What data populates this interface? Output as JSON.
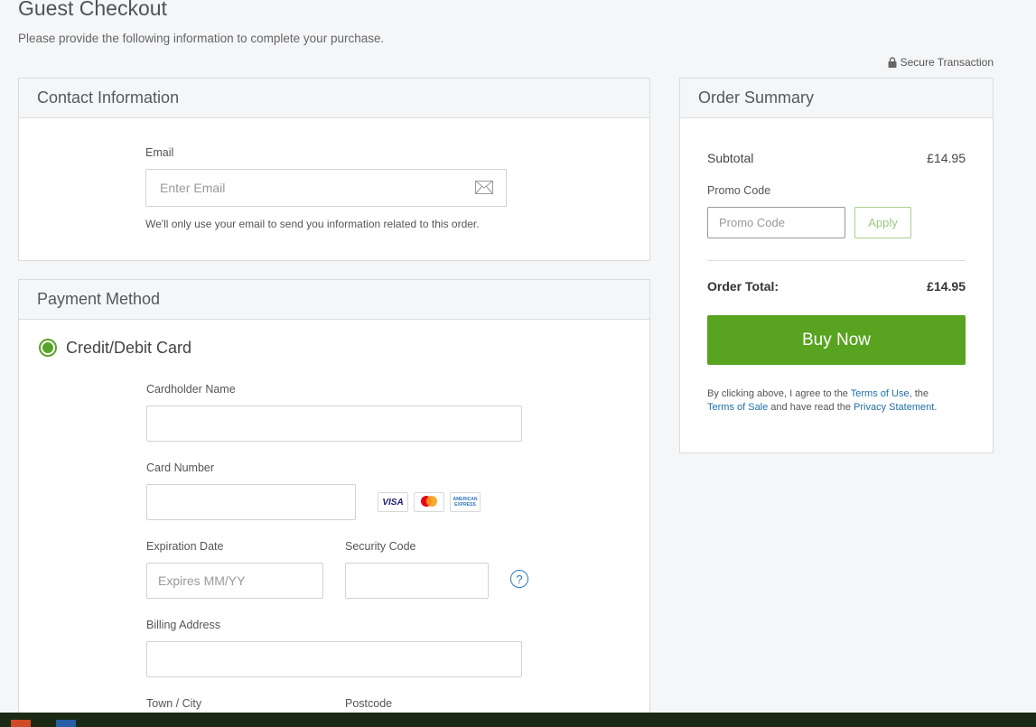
{
  "header": {
    "title": "Guest Checkout",
    "subtitle": "Please provide the following information to complete your purchase.",
    "secure_label": "Secure Transaction"
  },
  "contact": {
    "title": "Contact Information",
    "email_label": "Email",
    "email_placeholder": "Enter Email",
    "email_value": "",
    "email_hint": "We'll only use your email to send you information related to this order."
  },
  "payment": {
    "title": "Payment Method",
    "method_label": "Credit/Debit Card",
    "method_selected": true,
    "cardholder_label": "Cardholder Name",
    "cardholder_value": "",
    "card_number_label": "Card Number",
    "card_number_value": "",
    "card_brands": [
      "VISA",
      "Mastercard",
      "American Express"
    ],
    "expiration_label": "Expiration Date",
    "expiration_placeholder": "Expires MM/YY",
    "security_label": "Security Code",
    "security_value": "",
    "help_glyph": "?",
    "billing_label": "Billing Address",
    "billing_value": "",
    "town_label": "Town / City",
    "postcode_label": "Postcode"
  },
  "summary": {
    "title": "Order Summary",
    "subtotal_label": "Subtotal",
    "subtotal_value": "£14.95",
    "promo_label": "Promo Code",
    "promo_placeholder": "Promo Code",
    "apply_label": "Apply",
    "total_label": "Order Total:",
    "total_value": "£14.95",
    "buy_label": "Buy Now",
    "legal": {
      "prefix": "By clicking above, I agree to the ",
      "terms_use": "Terms of Use",
      "mid1": ", the ",
      "terms_sale": "Terms of Sale",
      "mid2": " and have read the ",
      "privacy": "Privacy Statement",
      "suffix": "."
    }
  },
  "colors": {
    "accent_green": "#58a31f",
    "link_blue": "#1f6fa8"
  }
}
